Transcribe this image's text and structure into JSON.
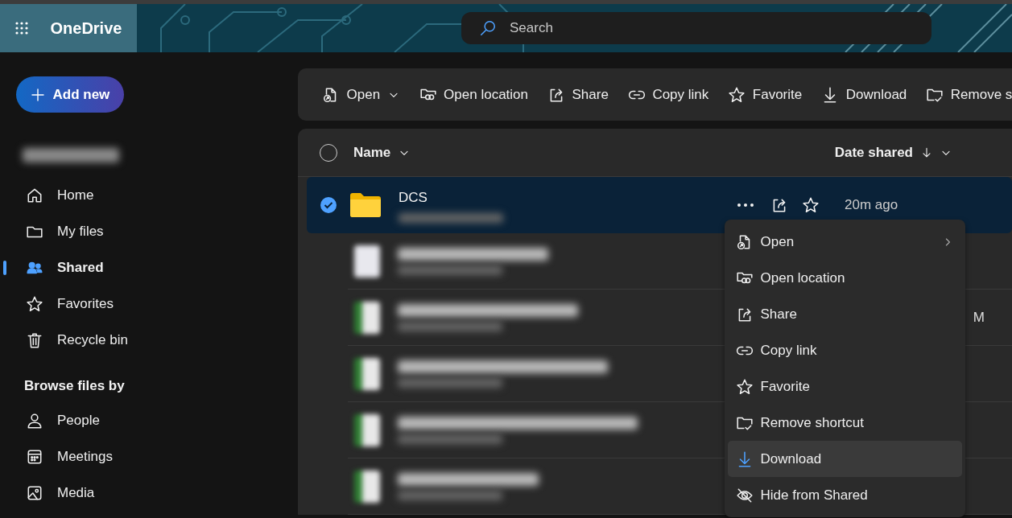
{
  "header": {
    "app_name": "OneDrive",
    "search": {
      "placeholder": "Search"
    }
  },
  "sidebar": {
    "add_button": "Add new",
    "nav": [
      {
        "label": "Home",
        "selected": false
      },
      {
        "label": "My files",
        "selected": false
      },
      {
        "label": "Shared",
        "selected": true
      },
      {
        "label": "Favorites",
        "selected": false
      },
      {
        "label": "Recycle bin",
        "selected": false
      }
    ],
    "section_heading": "Browse files by",
    "browse": [
      {
        "label": "People"
      },
      {
        "label": "Meetings"
      },
      {
        "label": "Media"
      }
    ]
  },
  "toolbar": [
    {
      "label": "Open",
      "dropdown": true
    },
    {
      "label": "Open location",
      "dropdown": false
    },
    {
      "label": "Share",
      "dropdown": false
    },
    {
      "label": "Copy link",
      "dropdown": false
    },
    {
      "label": "Favorite",
      "dropdown": false
    },
    {
      "label": "Download",
      "dropdown": false
    },
    {
      "label": "Remove s",
      "dropdown": false
    }
  ],
  "file_list": {
    "all_selected": false,
    "columns": [
      {
        "label": "Name",
        "sorted": false
      },
      {
        "label": "Date shared",
        "sorted": true
      }
    ],
    "rows": [
      {
        "kind": "folder",
        "name": "DCS",
        "date_shared": "20m ago",
        "selected": true
      },
      {
        "kind": "document",
        "selected": false
      },
      {
        "kind": "spreadsheet",
        "date_shared": "M",
        "selected": false
      },
      {
        "kind": "spreadsheet",
        "selected": false
      },
      {
        "kind": "spreadsheet",
        "selected": false
      },
      {
        "kind": "spreadsheet",
        "selected": false
      }
    ]
  },
  "context_menu": [
    {
      "label": "Open",
      "submenu": true,
      "highlighted": false
    },
    {
      "label": "Open location",
      "submenu": false,
      "highlighted": false
    },
    {
      "label": "Share",
      "submenu": false,
      "highlighted": false
    },
    {
      "label": "Copy link",
      "submenu": false,
      "highlighted": false
    },
    {
      "label": "Favorite",
      "submenu": false,
      "highlighted": false
    },
    {
      "label": "Remove shortcut",
      "submenu": false,
      "highlighted": false
    },
    {
      "label": "Download",
      "submenu": false,
      "highlighted": true
    },
    {
      "label": "Hide from Shared",
      "submenu": false,
      "highlighted": false
    }
  ]
}
